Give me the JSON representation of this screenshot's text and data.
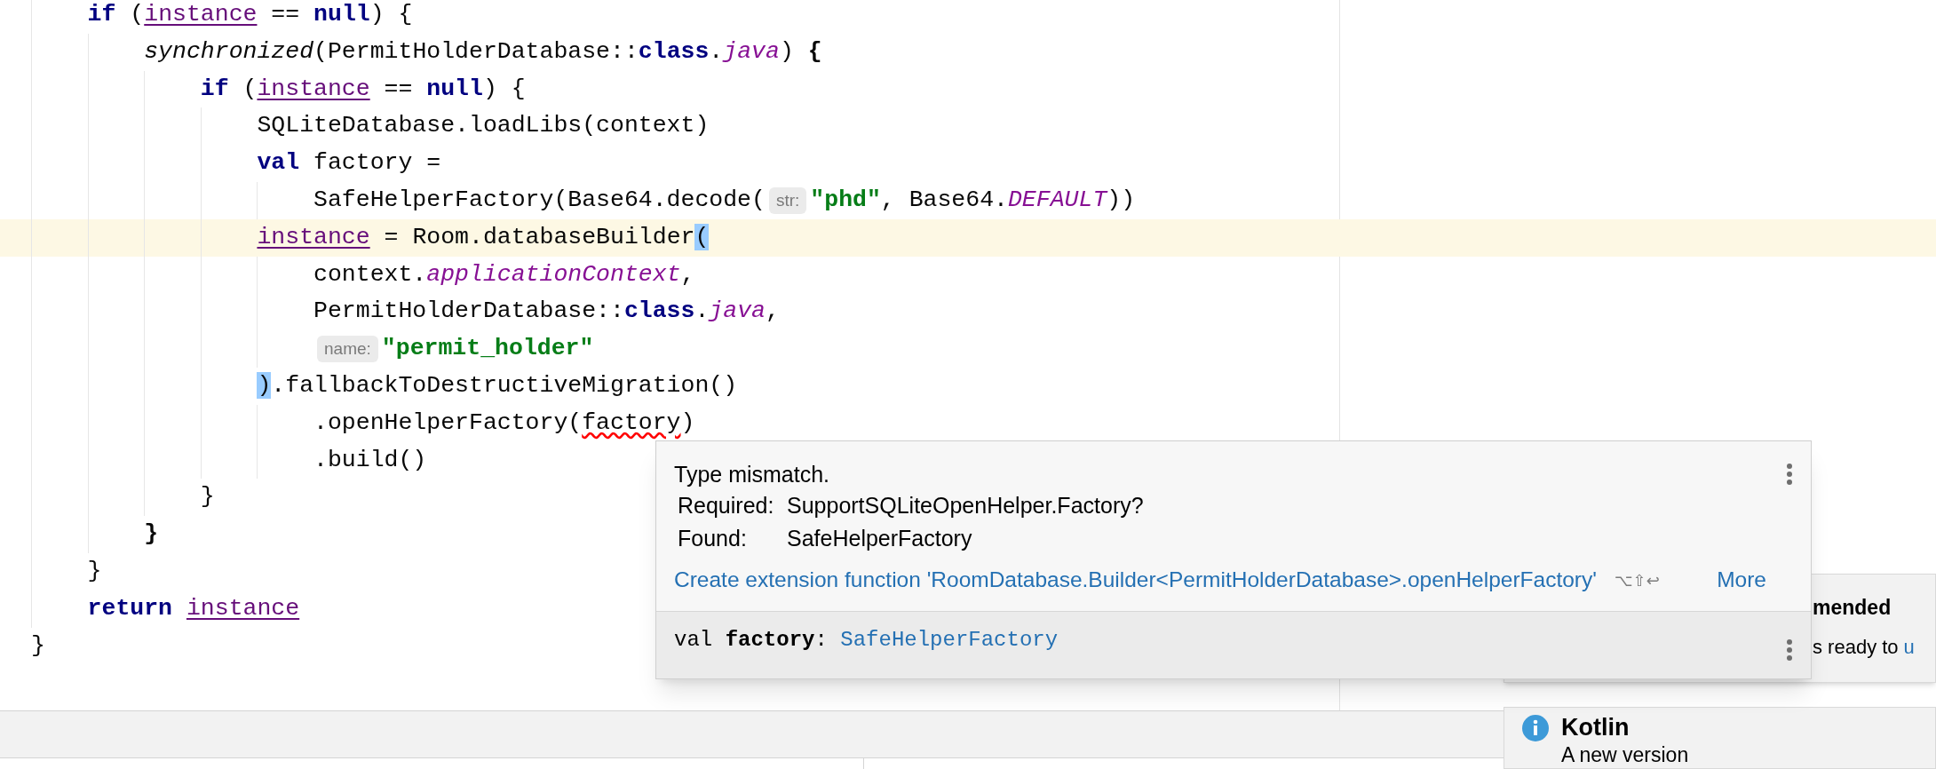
{
  "code": {
    "lines": [
      {
        "highlighted": false,
        "tokens": [
          {
            "kind": "kw",
            "text": "    if"
          },
          {
            "kind": "plain",
            "text": " ("
          },
          {
            "kind": "field",
            "text": "instance"
          },
          {
            "kind": "plain",
            "text": " == "
          },
          {
            "kind": "kw",
            "text": "null"
          },
          {
            "kind": "plain",
            "text": ") {"
          }
        ]
      },
      {
        "highlighted": false,
        "tokens": [
          {
            "kind": "italic",
            "text": "        synchronized"
          },
          {
            "kind": "plain",
            "text": "(PermitHolderDatabase::"
          },
          {
            "kind": "kw",
            "text": "class"
          },
          {
            "kind": "plain",
            "text": "."
          },
          {
            "kind": "prop",
            "text": "java"
          },
          {
            "kind": "plain",
            "text": ") "
          },
          {
            "kind": "bold",
            "text": "{"
          }
        ]
      },
      {
        "highlighted": false,
        "tokens": [
          {
            "kind": "kw",
            "text": "            if"
          },
          {
            "kind": "plain",
            "text": " ("
          },
          {
            "kind": "field",
            "text": "instance"
          },
          {
            "kind": "plain",
            "text": " == "
          },
          {
            "kind": "kw",
            "text": "null"
          },
          {
            "kind": "plain",
            "text": ") {"
          }
        ]
      },
      {
        "highlighted": false,
        "tokens": [
          {
            "kind": "plain",
            "text": "                SQLiteDatabase.loadLibs(context)"
          }
        ]
      },
      {
        "highlighted": false,
        "tokens": [
          {
            "kind": "kw",
            "text": "                val"
          },
          {
            "kind": "plain",
            "text": " factory ="
          }
        ]
      },
      {
        "highlighted": false,
        "tokens": [
          {
            "kind": "plain",
            "text": "                    SafeHelperFactory(Base64.decode("
          },
          {
            "kind": "hint",
            "text": "str:"
          },
          {
            "kind": "str",
            "text": "\"phd\""
          },
          {
            "kind": "plain",
            "text": ", Base64."
          },
          {
            "kind": "prop",
            "text": "DEFAULT"
          },
          {
            "kind": "plain",
            "text": "))"
          }
        ]
      },
      {
        "highlighted": true,
        "tokens": [
          {
            "kind": "field",
            "text": "                instance"
          },
          {
            "kind": "plain",
            "text": " = Room.databaseBuilder"
          },
          {
            "kind": "match",
            "text": "("
          }
        ]
      },
      {
        "highlighted": false,
        "tokens": [
          {
            "kind": "plain",
            "text": "                    context."
          },
          {
            "kind": "prop",
            "text": "applicationContext"
          },
          {
            "kind": "plain",
            "text": ","
          }
        ]
      },
      {
        "highlighted": false,
        "tokens": [
          {
            "kind": "plain",
            "text": "                    PermitHolderDatabase::"
          },
          {
            "kind": "kw",
            "text": "class"
          },
          {
            "kind": "plain",
            "text": "."
          },
          {
            "kind": "prop",
            "text": "java"
          },
          {
            "kind": "plain",
            "text": ","
          }
        ]
      },
      {
        "highlighted": false,
        "tokens": [
          {
            "kind": "hint",
            "text": "                    name:"
          },
          {
            "kind": "str",
            "text": "\"permit_holder\""
          }
        ]
      },
      {
        "highlighted": false,
        "tokens": [
          {
            "kind": "match",
            "text": "                )"
          },
          {
            "kind": "plain",
            "text": ".fallbackToDestructiveMigration()"
          }
        ]
      },
      {
        "highlighted": false,
        "tokens": [
          {
            "kind": "plain",
            "text": "                    .openHelperFactory("
          },
          {
            "kind": "error",
            "text": "factory"
          },
          {
            "kind": "plain",
            "text": ")"
          }
        ]
      },
      {
        "highlighted": false,
        "tokens": [
          {
            "kind": "plain",
            "text": "                    .build()"
          }
        ]
      },
      {
        "highlighted": false,
        "tokens": [
          {
            "kind": "plain",
            "text": "            }"
          }
        ]
      },
      {
        "highlighted": false,
        "tokens": [
          {
            "kind": "bold",
            "text": "        }"
          }
        ]
      },
      {
        "highlighted": false,
        "tokens": [
          {
            "kind": "plain",
            "text": "    }"
          }
        ]
      },
      {
        "highlighted": false,
        "tokens": [
          {
            "kind": "kw",
            "text": "    return "
          },
          {
            "kind": "field",
            "text": "instance"
          }
        ]
      },
      {
        "highlighted": false,
        "tokens": [
          {
            "kind": "plain",
            "text": "}"
          }
        ]
      }
    ]
  },
  "popup": {
    "title": "Type mismatch.",
    "rows": [
      {
        "label": "Required:",
        "value": "SupportSQLiteOpenHelper.Factory?"
      },
      {
        "label": "Found:",
        "value": "SafeHelperFactory"
      }
    ],
    "action": {
      "label": "Create extension function 'RoomDatabase.Builder<PermitHolderDatabase>.openHelperFactory'",
      "shortcut": "⌥⇧↩",
      "more": "More"
    },
    "declaration": {
      "keyword": "val",
      "name": "factory",
      "separator": ":",
      "type": "SafeHelperFactory"
    }
  },
  "notifications": [
    {
      "title": "mended",
      "text": "s ready to",
      "link": "u"
    },
    {
      "title": "Kotlin",
      "text": "A new version"
    }
  ]
}
